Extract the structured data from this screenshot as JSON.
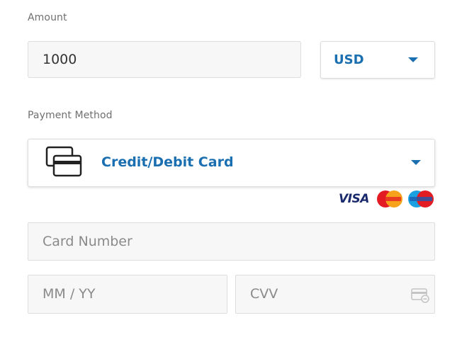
{
  "amount": {
    "label": "Amount",
    "value": "1000",
    "currency": "USD"
  },
  "payment_method": {
    "label": "Payment Method",
    "selected": "Credit/Debit Card",
    "icon": "credit-card-icon",
    "brands": [
      "VISA",
      "MasterCard",
      "Maestro"
    ]
  },
  "card": {
    "number_placeholder": "Card Number",
    "expiry_placeholder": "MM / YY",
    "cvv_placeholder": "CVV",
    "cvv_icon": "card-cvv-icon"
  },
  "colors": {
    "accent": "#1a6fb0",
    "field_bg": "#f7f7f7",
    "border": "#dddddd",
    "label": "#6f6f6f",
    "placeholder": "#8a8a8a"
  }
}
